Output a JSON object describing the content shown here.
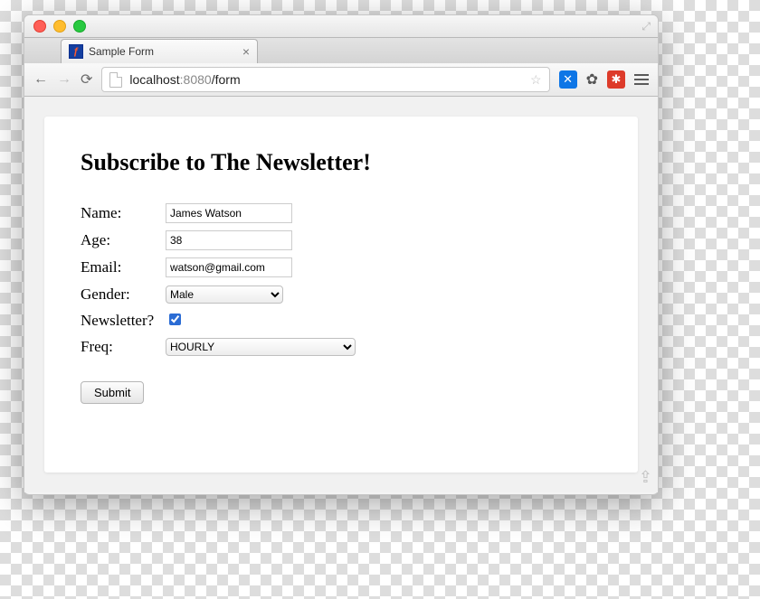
{
  "window": {
    "tab_title": "Sample Form",
    "url_host": "localhost",
    "url_port": ":8080",
    "url_path": "/form"
  },
  "page": {
    "heading": "Subscribe to The Newsletter!",
    "labels": {
      "name": "Name:",
      "age": "Age:",
      "email": "Email:",
      "gender": "Gender:",
      "newsletter": "Newsletter?",
      "freq": "Freq:"
    },
    "values": {
      "name": "James Watson",
      "age": "38",
      "email": "watson@gmail.com",
      "gender": "Male",
      "newsletter_checked": true,
      "freq": "HOURLY"
    },
    "submit": "Submit"
  }
}
